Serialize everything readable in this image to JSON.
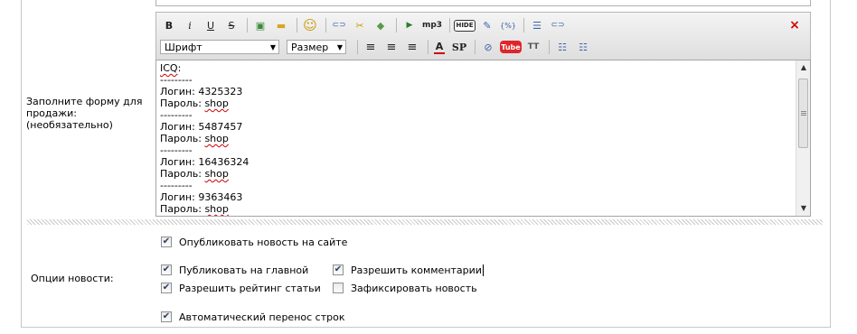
{
  "form": {
    "sale_label_lines": [
      "Заполните форму для",
      "продажи:",
      "(необязательно)"
    ],
    "options_label": "Опции новости:"
  },
  "toolbar": {
    "row1": [
      {
        "icon": "bold-icon",
        "glyph": "B"
      },
      {
        "icon": "italic-icon",
        "glyph": "i"
      },
      {
        "icon": "underline-icon",
        "glyph": "U"
      },
      {
        "icon": "strikethrough-icon",
        "glyph": "S"
      },
      {
        "sep": true
      },
      {
        "icon": "image-icon",
        "glyph": "▣"
      },
      {
        "icon": "folder-icon",
        "glyph": "▬"
      },
      {
        "sep": true
      },
      {
        "icon": "smiley-icon",
        "glyph": "☺"
      },
      {
        "sep": true
      },
      {
        "icon": "link-icon",
        "glyph": "⊂⊃"
      },
      {
        "icon": "unlink-icon",
        "glyph": "✂"
      },
      {
        "icon": "leech-icon",
        "glyph": "◆"
      },
      {
        "sep": true
      },
      {
        "icon": "media-icon",
        "glyph": "▶"
      },
      {
        "icon": "mp3-icon",
        "glyph": "mp3"
      },
      {
        "sep": true
      },
      {
        "icon": "hide-icon",
        "glyph": "HIDE"
      },
      {
        "icon": "quote-icon",
        "glyph": "✎"
      },
      {
        "icon": "code-icon",
        "glyph": "{%}"
      },
      {
        "sep": true
      },
      {
        "icon": "page-break-icon",
        "glyph": "☰"
      },
      {
        "icon": "page-link-icon",
        "glyph": "⊂⊃"
      }
    ],
    "close_glyph": "×",
    "font_select": "Шрифт",
    "size_select": "Размер",
    "row2": [
      {
        "sep": true
      },
      {
        "icon": "align-left-icon",
        "glyph": "≡"
      },
      {
        "icon": "align-center-icon",
        "glyph": "≡"
      },
      {
        "icon": "align-right-icon",
        "glyph": "≡"
      },
      {
        "sep": true
      },
      {
        "icon": "text-color-icon",
        "glyph": "A"
      },
      {
        "icon": "spoiler-icon",
        "glyph": "SP"
      },
      {
        "sep": true
      },
      {
        "icon": "flash-icon",
        "glyph": "⊘"
      },
      {
        "icon": "youtube-icon",
        "glyph": "Tube"
      },
      {
        "icon": "typograph-icon",
        "glyph": "TT"
      },
      {
        "sep": true
      },
      {
        "icon": "bullet-list-icon",
        "glyph": "☷"
      },
      {
        "icon": "numbered-list-icon",
        "glyph": "☷"
      }
    ]
  },
  "editor": {
    "lines": [
      [
        {
          "text": "ICQ",
          "spell": true
        },
        {
          "text": ":"
        }
      ],
      [
        {
          "text": "---------"
        }
      ],
      [
        {
          "text": "Логин: 4325323"
        }
      ],
      [
        {
          "text": "Пароль: "
        },
        {
          "text": "shop",
          "spell": true
        }
      ],
      [
        {
          "text": "---------"
        }
      ],
      [
        {
          "text": "Логин: 5487457"
        }
      ],
      [
        {
          "text": "Пароль: "
        },
        {
          "text": "shop",
          "spell": true
        }
      ],
      [
        {
          "text": "---------"
        }
      ],
      [
        {
          "text": "Логин: 16436324"
        }
      ],
      [
        {
          "text": "Пароль: "
        },
        {
          "text": "shop",
          "spell": true
        }
      ],
      [
        {
          "text": "---------"
        }
      ],
      [
        {
          "text": "Логин: 9363463"
        }
      ],
      [
        {
          "text": "Пароль: "
        },
        {
          "text": "shop",
          "spell": true
        }
      ]
    ]
  },
  "options": {
    "publish_on_site": {
      "label": "Опубликовать новость на сайте",
      "checked": true
    },
    "publish_main": {
      "label": "Публиковать на главной",
      "checked": true
    },
    "allow_comments": {
      "label": "Разрешить комментарии",
      "checked": true
    },
    "allow_rating": {
      "label": "Разрешить рейтинг статьи",
      "checked": true
    },
    "fix_news": {
      "label": "Зафиксировать новость",
      "checked": false
    },
    "auto_wrap": {
      "label": "Автоматический перенос строк",
      "checked": true
    }
  },
  "colors": {
    "accent_red": "#d00000",
    "youtube_red": "#e0262a",
    "check_mark": "#2a3d62"
  }
}
